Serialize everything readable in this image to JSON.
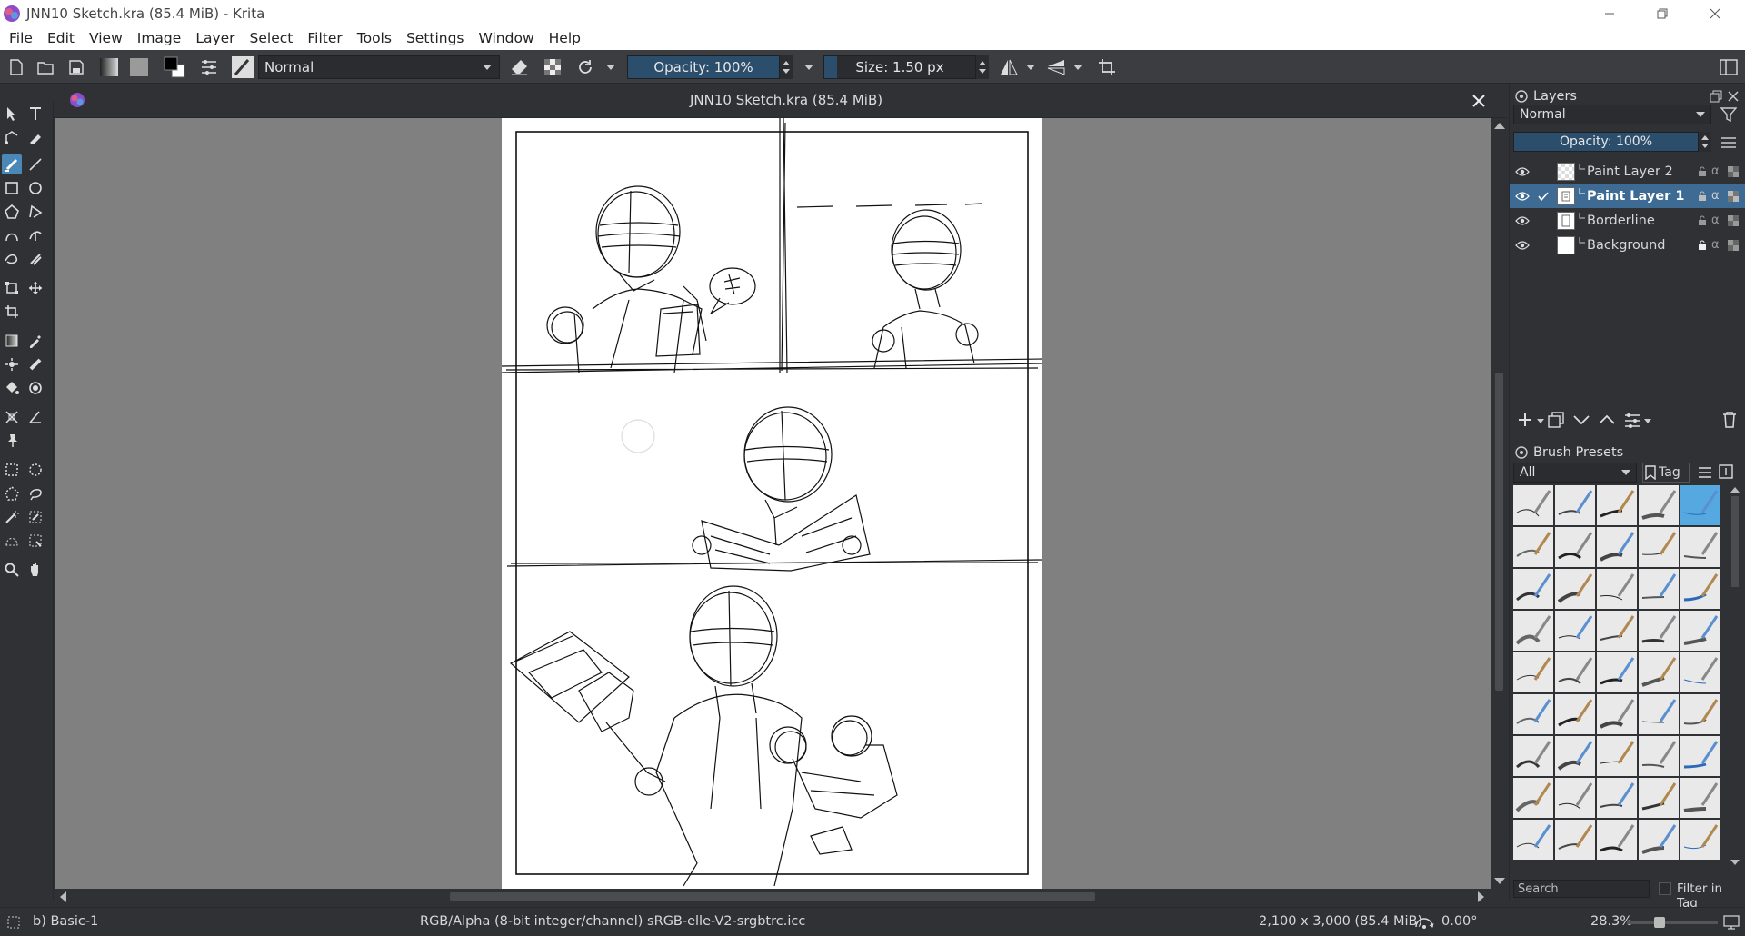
{
  "window": {
    "title": "JNN10 Sketch.kra (85.4 MiB)  - Krita"
  },
  "menu": [
    "File",
    "Edit",
    "View",
    "Image",
    "Layer",
    "Select",
    "Filter",
    "Tools",
    "Settings",
    "Window",
    "Help"
  ],
  "toolbar": {
    "blend_mode": "Normal",
    "opacity_label": "Opacity: 100%",
    "size_label": "Size: 1.50 px"
  },
  "document_tab": {
    "title": "JNN10 Sketch.kra (85.4 MiB)"
  },
  "layers_docker": {
    "title": "Layers",
    "blend_mode": "Normal",
    "opacity_label": "Opacity:  100%",
    "layers": [
      {
        "name": "Paint Layer 2",
        "selected": false,
        "checked": false
      },
      {
        "name": "Paint Layer 1",
        "selected": true,
        "checked": true
      },
      {
        "name": "Borderline",
        "selected": false,
        "checked": false
      },
      {
        "name": "Background",
        "selected": false,
        "checked": false
      }
    ]
  },
  "brush_presets": {
    "title": "Brush Presets",
    "filter": "All",
    "tag_label": "Tag",
    "search_placeholder": "Search",
    "filter_in_tag": "Filter in Tag"
  },
  "statusbar": {
    "brush_name": "b) Basic-1",
    "color_info": "RGB/Alpha (8-bit integer/channel)  sRGB-elle-V2-srgbtrc.icc",
    "image_size": "2,100 x 3,000 (85.4 MiB)",
    "rotation": "0.00°",
    "zoom": "28.3%"
  },
  "colors": {
    "accent": "#3d6b94",
    "canvas_bg": "#808080",
    "panel_bg": "#2f3135",
    "slider_fill": "#2c4e6d"
  }
}
